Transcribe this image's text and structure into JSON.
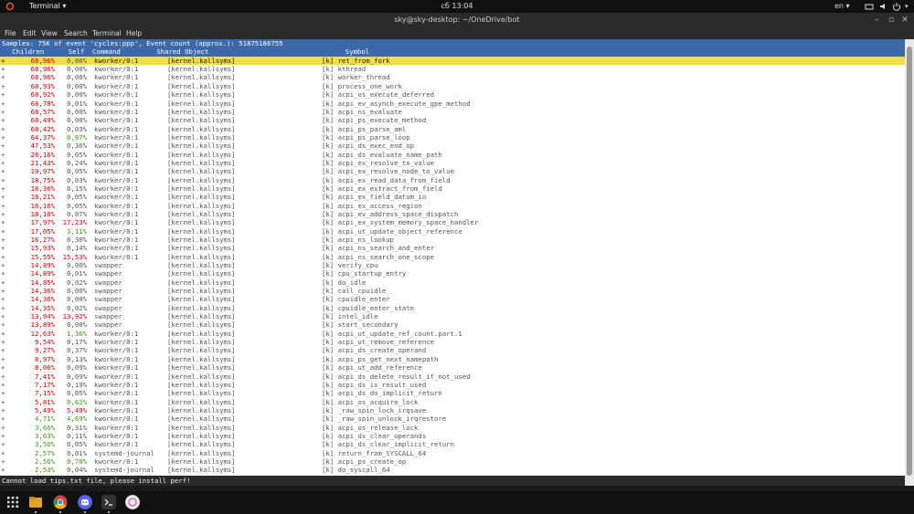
{
  "topbar": {
    "app_menu": "Terminal ▾",
    "clock": "сб 13:04",
    "lang": "en ▾",
    "icons": [
      "activities-icon",
      "network-icon",
      "volume-icon",
      "power-icon"
    ]
  },
  "window": {
    "title": "sky@sky-desktop: ~/OneDrive/bot",
    "buttons": [
      "minimize",
      "maximize",
      "close"
    ]
  },
  "menubar": [
    "File",
    "Edit",
    "View",
    "Search",
    "Terminal",
    "Help"
  ],
  "perf": {
    "summary": "Samples: 75K of event 'cycles:ppp', Event count (approx.): 51875186755",
    "header": "   Children      Self  Command         Shared Object                                  Symbol",
    "rows": [
      {
        "p": "+",
        "ch": "68,96%",
        "self": "0,00%",
        "cmd": "kworker/0:1",
        "so": "[kernel.kallsyms]",
        "sym": "[k] ret_from_fork",
        "chc": "red",
        "sc": "gry"
      },
      {
        "p": "+",
        "ch": "68,96%",
        "self": "0,00%",
        "cmd": "kworker/0:1",
        "so": "[kernel.kallsyms]",
        "sym": "[k] kthread",
        "chc": "red",
        "sc": "gry"
      },
      {
        "p": "+",
        "ch": "68,96%",
        "self": "0,00%",
        "cmd": "kworker/0:1",
        "so": "[kernel.kallsyms]",
        "sym": "[k] worker_thread",
        "chc": "red",
        "sc": "gry"
      },
      {
        "p": "+",
        "ch": "68,93%",
        "self": "0,00%",
        "cmd": "kworker/0:1",
        "so": "[kernel.kallsyms]",
        "sym": "[k] process_one_work",
        "chc": "red",
        "sc": "gry"
      },
      {
        "p": "+",
        "ch": "68,92%",
        "self": "0,00%",
        "cmd": "kworker/0:1",
        "so": "[kernel.kallsyms]",
        "sym": "[k] acpi_os_execute_deferred",
        "chc": "red",
        "sc": "gry"
      },
      {
        "p": "+",
        "ch": "68,70%",
        "self": "0,01%",
        "cmd": "kworker/0:1",
        "so": "[kernel.kallsyms]",
        "sym": "[k] acpi_ev_asynch_execute_gpe_method",
        "chc": "red",
        "sc": "gry"
      },
      {
        "p": "+",
        "ch": "68,57%",
        "self": "0,00%",
        "cmd": "kworker/0:1",
        "so": "[kernel.kallsyms]",
        "sym": "[k] acpi_ns_evaluate",
        "chc": "red",
        "sc": "gry"
      },
      {
        "p": "+",
        "ch": "68,49%",
        "self": "0,00%",
        "cmd": "kworker/0:1",
        "so": "[kernel.kallsyms]",
        "sym": "[k] acpi_ps_execute_method",
        "chc": "red",
        "sc": "gry"
      },
      {
        "p": "+",
        "ch": "68,42%",
        "self": "0,03%",
        "cmd": "kworker/0:1",
        "so": "[kernel.kallsyms]",
        "sym": "[k] acpi_ps_parse_aml",
        "chc": "red",
        "sc": "gry"
      },
      {
        "p": "+",
        "ch": "64,37%",
        "self": "0,87%",
        "cmd": "kworker/0:1",
        "so": "[kernel.kallsyms]",
        "sym": "[k] acpi_ps_parse_loop",
        "chc": "red",
        "sc": "grn"
      },
      {
        "p": "+",
        "ch": "47,53%",
        "self": "0,36%",
        "cmd": "kworker/0:1",
        "so": "[kernel.kallsyms]",
        "sym": "[k] acpi_ds_exec_end_op",
        "chc": "red",
        "sc": "gry"
      },
      {
        "p": "+",
        "ch": "28,16%",
        "self": "0,05%",
        "cmd": "kworker/0:1",
        "so": "[kernel.kallsyms]",
        "sym": "[k] acpi_ds_evaluate_name_path",
        "chc": "red",
        "sc": "gry"
      },
      {
        "p": "+",
        "ch": "21,43%",
        "self": "0,24%",
        "cmd": "kworker/0:1",
        "so": "[kernel.kallsyms]",
        "sym": "[k] acpi_ex_resolve_to_value",
        "chc": "red",
        "sc": "gry"
      },
      {
        "p": "+",
        "ch": "19,97%",
        "self": "0,05%",
        "cmd": "kworker/0:1",
        "so": "[kernel.kallsyms]",
        "sym": "[k] acpi_ex_resolve_node_to_value",
        "chc": "red",
        "sc": "gry"
      },
      {
        "p": "+",
        "ch": "18,75%",
        "self": "0,03%",
        "cmd": "kworker/0:1",
        "so": "[kernel.kallsyms]",
        "sym": "[k] acpi_ex_read_data_from_field",
        "chc": "red",
        "sc": "gry"
      },
      {
        "p": "+",
        "ch": "18,36%",
        "self": "0,15%",
        "cmd": "kworker/0:1",
        "so": "[kernel.kallsyms]",
        "sym": "[k] acpi_ex_extract_from_field",
        "chc": "red",
        "sc": "gry"
      },
      {
        "p": "+",
        "ch": "18,21%",
        "self": "0,05%",
        "cmd": "kworker/0:1",
        "so": "[kernel.kallsyms]",
        "sym": "[k] acpi_ex_field_datum_io",
        "chc": "red",
        "sc": "gry"
      },
      {
        "p": "+",
        "ch": "18,16%",
        "self": "0,05%",
        "cmd": "kworker/0:1",
        "so": "[kernel.kallsyms]",
        "sym": "[k] acpi_ex_access_region",
        "chc": "red",
        "sc": "gry"
      },
      {
        "p": "+",
        "ch": "18,10%",
        "self": "0,07%",
        "cmd": "kworker/0:1",
        "so": "[kernel.kallsyms]",
        "sym": "[k] acpi_ev_address_space_dispatch",
        "chc": "red",
        "sc": "gry"
      },
      {
        "p": "+",
        "ch": "17,97%",
        "self": "17,23%",
        "cmd": "kworker/0:1",
        "so": "[kernel.kallsyms]",
        "sym": "[k] acpi_ex_system_memory_space_handler",
        "chc": "red",
        "sc": "red"
      },
      {
        "p": "+",
        "ch": "17,05%",
        "self": "3,11%",
        "cmd": "kworker/0:1",
        "so": "[kernel.kallsyms]",
        "sym": "[k] acpi_ut_update_object_reference",
        "chc": "red",
        "sc": "grn"
      },
      {
        "p": "+",
        "ch": "16,27%",
        "self": "0,30%",
        "cmd": "kworker/0:1",
        "so": "[kernel.kallsyms]",
        "sym": "[k] acpi_ns_lookup",
        "chc": "red",
        "sc": "gry"
      },
      {
        "p": "+",
        "ch": "15,93%",
        "self": "0,14%",
        "cmd": "kworker/0:1",
        "so": "[kernel.kallsyms]",
        "sym": "[k] acpi_ns_search_and_enter",
        "chc": "red",
        "sc": "gry"
      },
      {
        "p": "+",
        "ch": "15,55%",
        "self": "15,53%",
        "cmd": "kworker/0:1",
        "so": "[kernel.kallsyms]",
        "sym": "[k] acpi_ns_search_one_scope",
        "chc": "red",
        "sc": "red"
      },
      {
        "p": "+",
        "ch": "14,89%",
        "self": "0,00%",
        "cmd": "swapper",
        "so": "[kernel.kallsyms]",
        "sym": "[k] verify_cpu",
        "chc": "red",
        "sc": "gry"
      },
      {
        "p": "+",
        "ch": "14,89%",
        "self": "0,01%",
        "cmd": "swapper",
        "so": "[kernel.kallsyms]",
        "sym": "[k] cpu_startup_entry",
        "chc": "red",
        "sc": "gry"
      },
      {
        "p": "+",
        "ch": "14,85%",
        "self": "0,02%",
        "cmd": "swapper",
        "so": "[kernel.kallsyms]",
        "sym": "[k] do_idle",
        "chc": "red",
        "sc": "gry"
      },
      {
        "p": "+",
        "ch": "14,36%",
        "self": "0,00%",
        "cmd": "swapper",
        "so": "[kernel.kallsyms]",
        "sym": "[k] call_cpuidle",
        "chc": "red",
        "sc": "gry"
      },
      {
        "p": "+",
        "ch": "14,36%",
        "self": "0,00%",
        "cmd": "swapper",
        "so": "[kernel.kallsyms]",
        "sym": "[k] cpuidle_enter",
        "chc": "red",
        "sc": "gry"
      },
      {
        "p": "+",
        "ch": "14,35%",
        "self": "0,02%",
        "cmd": "swapper",
        "so": "[kernel.kallsyms]",
        "sym": "[k] cpuidle_enter_state",
        "chc": "red",
        "sc": "gry"
      },
      {
        "p": "+",
        "ch": "13,94%",
        "self": "13,92%",
        "cmd": "swapper",
        "so": "[kernel.kallsyms]",
        "sym": "[k] intel_idle",
        "chc": "red",
        "sc": "red"
      },
      {
        "p": "+",
        "ch": "13,89%",
        "self": "0,00%",
        "cmd": "swapper",
        "so": "[kernel.kallsyms]",
        "sym": "[k] start_secondary",
        "chc": "red",
        "sc": "gry"
      },
      {
        "p": "+",
        "ch": "12,63%",
        "self": "1,36%",
        "cmd": "kworker/0:1",
        "so": "[kernel.kallsyms]",
        "sym": "[k] acpi_ut_update_ref_count.part.1",
        "chc": "red",
        "sc": "grn"
      },
      {
        "p": "+",
        "ch": "9,54%",
        "self": "0,17%",
        "cmd": "kworker/0:1",
        "so": "[kernel.kallsyms]",
        "sym": "[k] acpi_ut_remove_reference",
        "chc": "red",
        "sc": "gry"
      },
      {
        "p": "+",
        "ch": "9,27%",
        "self": "0,37%",
        "cmd": "kworker/0:1",
        "so": "[kernel.kallsyms]",
        "sym": "[k] acpi_ds_create_operand",
        "chc": "red",
        "sc": "gry"
      },
      {
        "p": "+",
        "ch": "8,97%",
        "self": "0,13%",
        "cmd": "kworker/0:1",
        "so": "[kernel.kallsyms]",
        "sym": "[k] acpi_ps_get_next_namepath",
        "chc": "red",
        "sc": "gry"
      },
      {
        "p": "+",
        "ch": "8,06%",
        "self": "0,09%",
        "cmd": "kworker/0:1",
        "so": "[kernel.kallsyms]",
        "sym": "[k] acpi_ut_add_reference",
        "chc": "red",
        "sc": "gry"
      },
      {
        "p": "+",
        "ch": "7,41%",
        "self": "0,09%",
        "cmd": "kworker/0:1",
        "so": "[kernel.kallsyms]",
        "sym": "[k] acpi_ds_delete_result_if_not_used",
        "chc": "red",
        "sc": "gry"
      },
      {
        "p": "+",
        "ch": "7,17%",
        "self": "0,19%",
        "cmd": "kworker/0:1",
        "so": "[kernel.kallsyms]",
        "sym": "[k] acpi_ds_is_result_used",
        "chc": "red",
        "sc": "gry"
      },
      {
        "p": "+",
        "ch": "7,15%",
        "self": "0,05%",
        "cmd": "kworker/0:1",
        "so": "[kernel.kallsyms]",
        "sym": "[k] acpi_ds_do_implicit_return",
        "chc": "red",
        "sc": "gry"
      },
      {
        "p": "+",
        "ch": "5,81%",
        "self": "0,62%",
        "cmd": "kworker/0:1",
        "so": "[kernel.kallsyms]",
        "sym": "[k] acpi_os_acquire_lock",
        "chc": "red",
        "sc": "grn"
      },
      {
        "p": "+",
        "ch": "5,49%",
        "self": "5,49%",
        "cmd": "kworker/0:1",
        "so": "[kernel.kallsyms]",
        "sym": "[k] _raw_spin_lock_irqsave",
        "chc": "red",
        "sc": "red"
      },
      {
        "p": "+",
        "ch": "4,71%",
        "self": "4,69%",
        "cmd": "kworker/0:1",
        "so": "[kernel.kallsyms]",
        "sym": "[k] _raw_spin_unlock_irqrestore",
        "chc": "grn",
        "sc": "grn"
      },
      {
        "p": "+",
        "ch": "3,66%",
        "self": "0,31%",
        "cmd": "kworker/0:1",
        "so": "[kernel.kallsyms]",
        "sym": "[k] acpi_os_release_lock",
        "chc": "grn",
        "sc": "gry"
      },
      {
        "p": "+",
        "ch": "3,63%",
        "self": "0,11%",
        "cmd": "kworker/0:1",
        "so": "[kernel.kallsyms]",
        "sym": "[k] acpi_ds_clear_operands",
        "chc": "grn",
        "sc": "gry"
      },
      {
        "p": "+",
        "ch": "3,56%",
        "self": "0,05%",
        "cmd": "kworker/0:1",
        "so": "[kernel.kallsyms]",
        "sym": "[k] acpi_ds_clear_implicit_return",
        "chc": "grn",
        "sc": "gry"
      },
      {
        "p": "+",
        "ch": "2,57%",
        "self": "0,01%",
        "cmd": "systemd-journal",
        "so": "[kernel.kallsyms]",
        "sym": "[k] return_from_SYSCALL_64",
        "chc": "grn",
        "sc": "gry"
      },
      {
        "p": "+",
        "ch": "2,56%",
        "self": "0,78%",
        "cmd": "kworker/0:1",
        "so": "[kernel.kallsyms]",
        "sym": "[k] acpi_ps_create_op",
        "chc": "grn",
        "sc": "grn"
      },
      {
        "p": "+",
        "ch": "2,53%",
        "self": "0,04%",
        "cmd": "systemd-journal",
        "so": "[kernel.kallsyms]",
        "sym": "[k] do_syscall_64",
        "chc": "grn",
        "sc": "gry"
      }
    ],
    "status": "Cannot load tips.txt file, please install perf!"
  },
  "dock": {
    "apps": [
      "show-apps-icon",
      "files-icon",
      "chrome-icon",
      "discord-icon",
      "terminal-icon",
      "app-icon"
    ]
  },
  "colors": {
    "header_bg": "#3c6aa8",
    "selected_bg": "#f2de3e",
    "red": "#cc0000",
    "green": "#3a9a16"
  }
}
